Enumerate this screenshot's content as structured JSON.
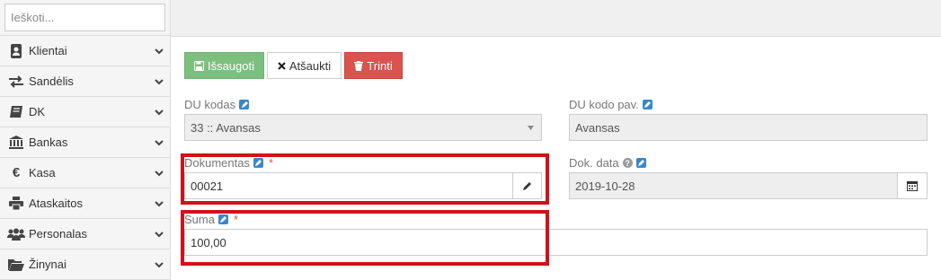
{
  "sidebar": {
    "search_placeholder": "Ieškoti...",
    "items": [
      {
        "label": "Klientai",
        "icon": "address-book-icon"
      },
      {
        "label": "Sandėlis",
        "icon": "exchange-arrows-icon"
      },
      {
        "label": "DK",
        "icon": "book-icon"
      },
      {
        "label": "Bankas",
        "icon": "bank-icon"
      },
      {
        "label": "Kasa",
        "icon": "euro-icon"
      },
      {
        "label": "Ataskaitos",
        "icon": "printer-icon"
      },
      {
        "label": "Personalas",
        "icon": "users-icon"
      },
      {
        "label": "Žinynai",
        "icon": "folder-open-icon"
      }
    ]
  },
  "toolbar": {
    "save_label": "Išsaugoti",
    "cancel_label": "Atšaukti",
    "delete_label": "Trinti"
  },
  "form": {
    "du_kodas_label": "DU kodas",
    "du_kodas_value": "33 :: Avansas",
    "du_kodo_pav_label": "DU kodo pav.",
    "du_kodo_pav_value": "Avansas",
    "dokumentas_label": "Dokumentas",
    "dokumentas_value": "00021",
    "dok_data_label": "Dok. data",
    "dok_data_value": "2019-10-28",
    "suma_label": "Suma",
    "suma_value": "100,00",
    "required_mark": "*"
  },
  "colors": {
    "save": "#7cbf7f",
    "delete": "#d9534f",
    "highlight": "#d0121b",
    "edit_icon": "#3a87c8"
  }
}
